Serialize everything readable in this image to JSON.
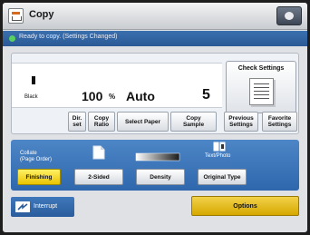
{
  "header": {
    "title": "Copy"
  },
  "status": {
    "text": "Ready to copy. (Settings Changed)"
  },
  "main": {
    "color_mode": "Black",
    "ratio": "100",
    "ratio_unit": "%",
    "paper": "Auto",
    "copies": "5",
    "check_settings": "Check Settings"
  },
  "buttons": {
    "dir_set": "Dir.\nset",
    "copy_ratio": "Copy\nRatio",
    "select_paper": "Select Paper",
    "copy_sample": "Copy\nSample",
    "previous_settings": "Previous\nSettings",
    "favorite_settings": "Favorite\nSettings"
  },
  "functions": {
    "collate_label": "Collate\n(Page Order)",
    "finishing": "Finishing",
    "two_sided": "2-Sided",
    "density": "Density",
    "text_photo_label": "Text/Photo",
    "original_type": "Original Type"
  },
  "bottom": {
    "interrupt": "Interrupt",
    "options": "Options"
  },
  "colors": {
    "status_bar": "#2f62a0",
    "panel_blue": "#3d76ba",
    "finishing_yellow": "#f5df1c",
    "options_yellow": "#e6bd1c"
  }
}
